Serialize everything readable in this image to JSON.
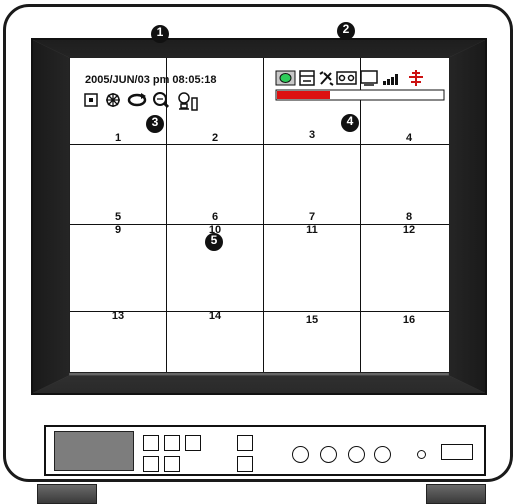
{
  "datetime": "2005/JUN/03 pm 08:05:18",
  "channels": [
    "1",
    "2",
    "3",
    "4",
    "5",
    "6",
    "7",
    "8",
    "9",
    "10",
    "11",
    "12",
    "13",
    "14",
    "15",
    "16"
  ],
  "callouts": [
    "1",
    "2",
    "3",
    "4",
    "5"
  ],
  "colors": {
    "record_bar": "#dd1111",
    "status_green": "#2ecc5a",
    "alarm_red": "#cc1111",
    "panel_display": "#7d7d7d"
  },
  "icons": {
    "status_left": [
      "record-icon",
      "fan-icon",
      "loop-icon",
      "zoom-icon",
      "sensor-icon"
    ],
    "status_right": [
      "active-indicator-icon",
      "hdd-icon",
      "tool-icon",
      "tape-icon",
      "monitor-icon",
      "signal-icon",
      "alarm-icon"
    ]
  },
  "hdd_usage_fraction": 0.32
}
